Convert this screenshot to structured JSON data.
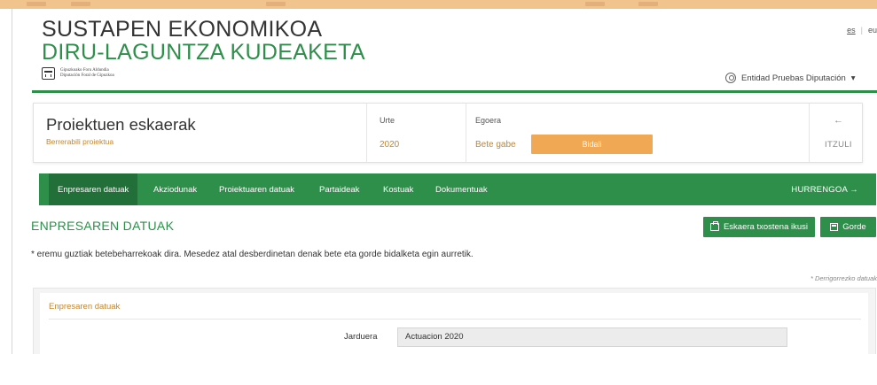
{
  "header": {
    "brand_line1": "SUSTAPEN EKONOMIKOA",
    "brand_line2": "DIRU-LAGUNTZA KUDEAKETA",
    "logo_line1": "Gipuzkoako Foru Aldundia",
    "logo_line2": "Diputación Foral de Gipuzkoa",
    "lang_other": "es",
    "lang_active": "eu",
    "user_name": "Entidad Pruebas Diputación",
    "user_caret": "▾"
  },
  "summary": {
    "title": "Proiektuen eskaerak",
    "subtitle": "Berrerabili proiektua",
    "year_label": "Urte",
    "year_value": "2020",
    "status_label": "Egoera",
    "status_value": "Bete gabe",
    "send_button": "Bidali",
    "back_arrow": "←",
    "back_label": "ITZULI"
  },
  "nav": {
    "tabs": [
      {
        "label": "Enpresaren datuak"
      },
      {
        "label": "Akziodunak"
      },
      {
        "label": "Proiektuaren datuak"
      },
      {
        "label": "Partaideak"
      },
      {
        "label": "Kostuak"
      },
      {
        "label": "Dokumentuak"
      }
    ],
    "next_label": "HURRENGOA →"
  },
  "main": {
    "section_title": "ENPRESAREN DATUAK",
    "view_request_button": "Eskaera txostena ikusi",
    "save_button": "Gorde",
    "notice": "* eremu guztiak betebeharrekoak dira. Mesedez atal desberdinetan denak bete eta gorde bidalketa egin aurretik.",
    "required_note": "* Derrigorrezko datuak",
    "panel_title": "Enpresaren datuak",
    "field_label": "Jarduera",
    "field_value": "Actuacion 2020"
  },
  "colors": {
    "brand_green": "#2e8f4b",
    "accent_orange": "#f0a855",
    "label_orange": "#c2862f"
  }
}
